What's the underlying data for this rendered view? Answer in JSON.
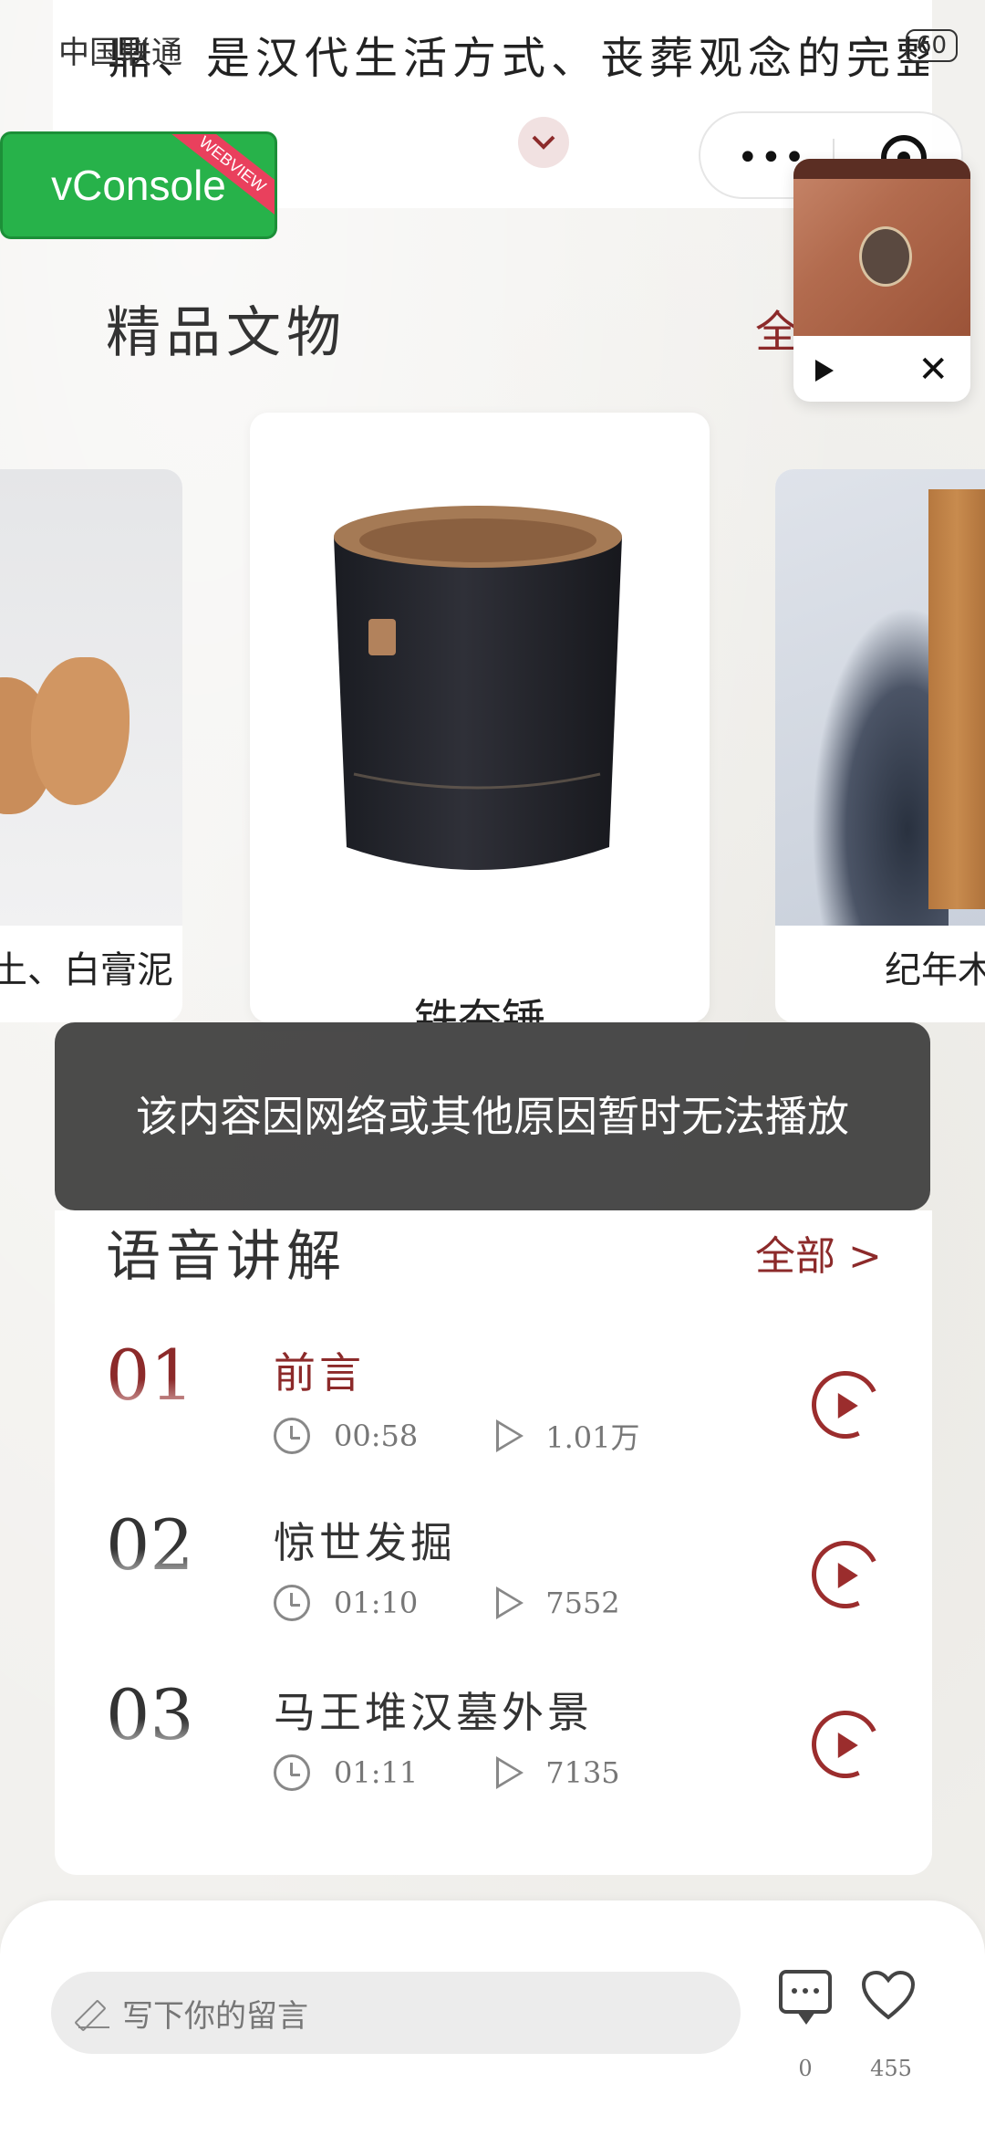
{
  "status_bar": {
    "carrier": "中国联通",
    "battery": "60"
  },
  "intro": {
    "text": "鼎、是汉代生活方式、丧葬观念的完整",
    "expand_icon": "chevron-down-icon"
  },
  "vconsole": {
    "label": "vConsole",
    "ribbon": "WEBVIEW"
  },
  "capsule": {
    "more_icon": "more-dots-icon",
    "close_icon": "target-icon"
  },
  "mini_player": {
    "play_icon": "play-icon",
    "close_icon": "close-icon"
  },
  "relics": {
    "title": "精品文物",
    "more": "全",
    "items": [
      {
        "name": "土、白膏泥"
      },
      {
        "name": "铁夯锤"
      },
      {
        "name": "纪年木"
      }
    ]
  },
  "toast": {
    "text": "该内容因网络或其他原因暂时无法播放"
  },
  "audio": {
    "title": "语音讲解",
    "more": "全部 >",
    "items": [
      {
        "num": "01",
        "title": "前言",
        "duration": "00:58",
        "plays": "1.01万",
        "active": true
      },
      {
        "num": "02",
        "title": "惊世发掘",
        "duration": "01:10",
        "plays": "7552",
        "active": false
      },
      {
        "num": "03",
        "title": "马王堆汉墓外景",
        "duration": "01:11",
        "plays": "7135",
        "active": false
      }
    ]
  },
  "bottom_bar": {
    "comment_placeholder": "写下你的留言",
    "comment_count": "0",
    "like_count": "455"
  },
  "colors": {
    "accent": "#8c2a2a",
    "vconsole_green": "#27b24a",
    "toast_bg": "#3c3c3c"
  }
}
